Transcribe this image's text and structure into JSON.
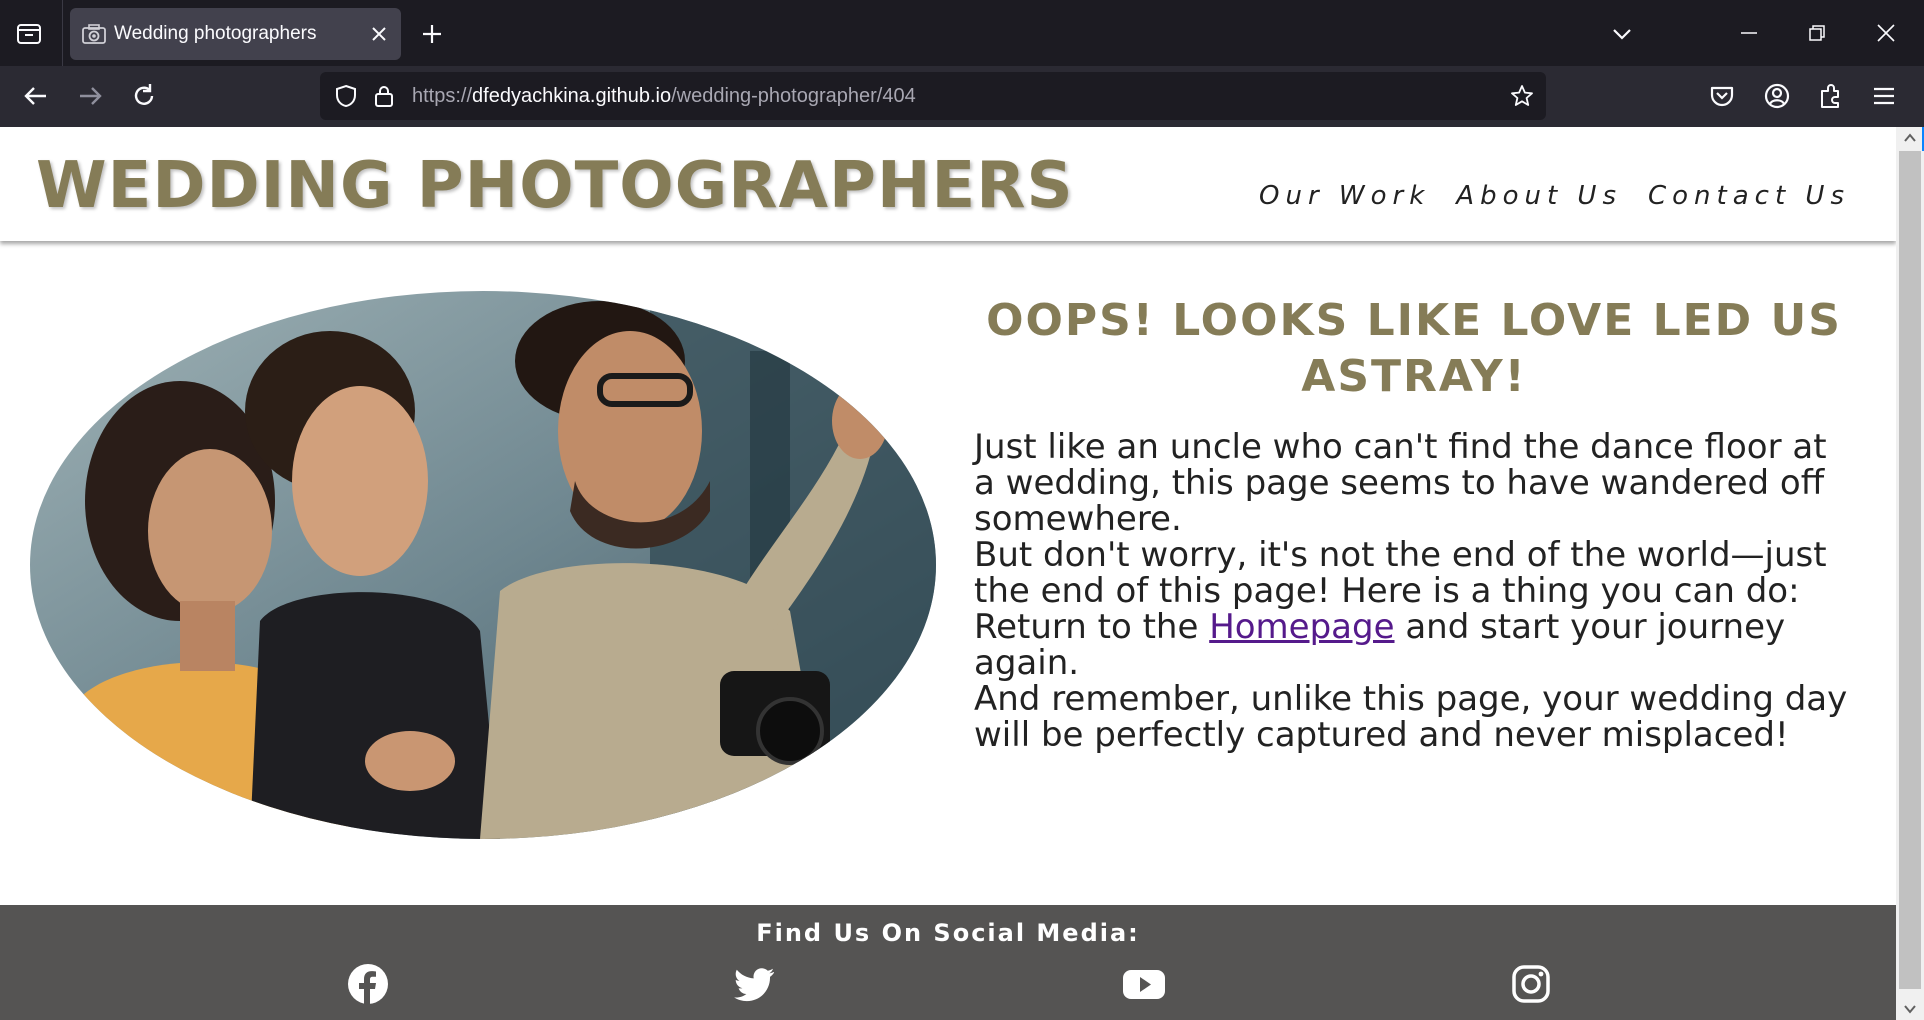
{
  "browser": {
    "tab_title": "Wedding photographers",
    "url_protocol": "https://",
    "url_host": "dfedyachkina.github.io",
    "url_path": "/wedding-photographer/404"
  },
  "site": {
    "logo": "WEDDING PHOTOGRAPHERS",
    "nav": [
      "Our Work",
      "About Us",
      "Contact Us"
    ]
  },
  "content": {
    "headline": "OOPS! LOOKS LIKE LOVE LED US ASTRAY!",
    "para1": "Just like an uncle who can't find the dance floor at a wedding, this page seems to have wandered off somewhere.",
    "para2": "But don't worry, it's not the end of the world—just the end of this page! Here is a thing you can do:",
    "para3_before": "Return to the ",
    "para3_link": "Homepage",
    "para3_after": " and start your journey again.",
    "para4": "And remember, unlike this page, your wedding day will be perfectly captured and never misplaced!"
  },
  "footer": {
    "title": "Find Us On Social Media:",
    "icons": [
      "facebook-icon",
      "twitter-icon",
      "youtube-icon",
      "instagram-icon"
    ]
  },
  "colors": {
    "brand": "#857c57",
    "footer_bg": "#555453",
    "link": "#551a8b"
  }
}
